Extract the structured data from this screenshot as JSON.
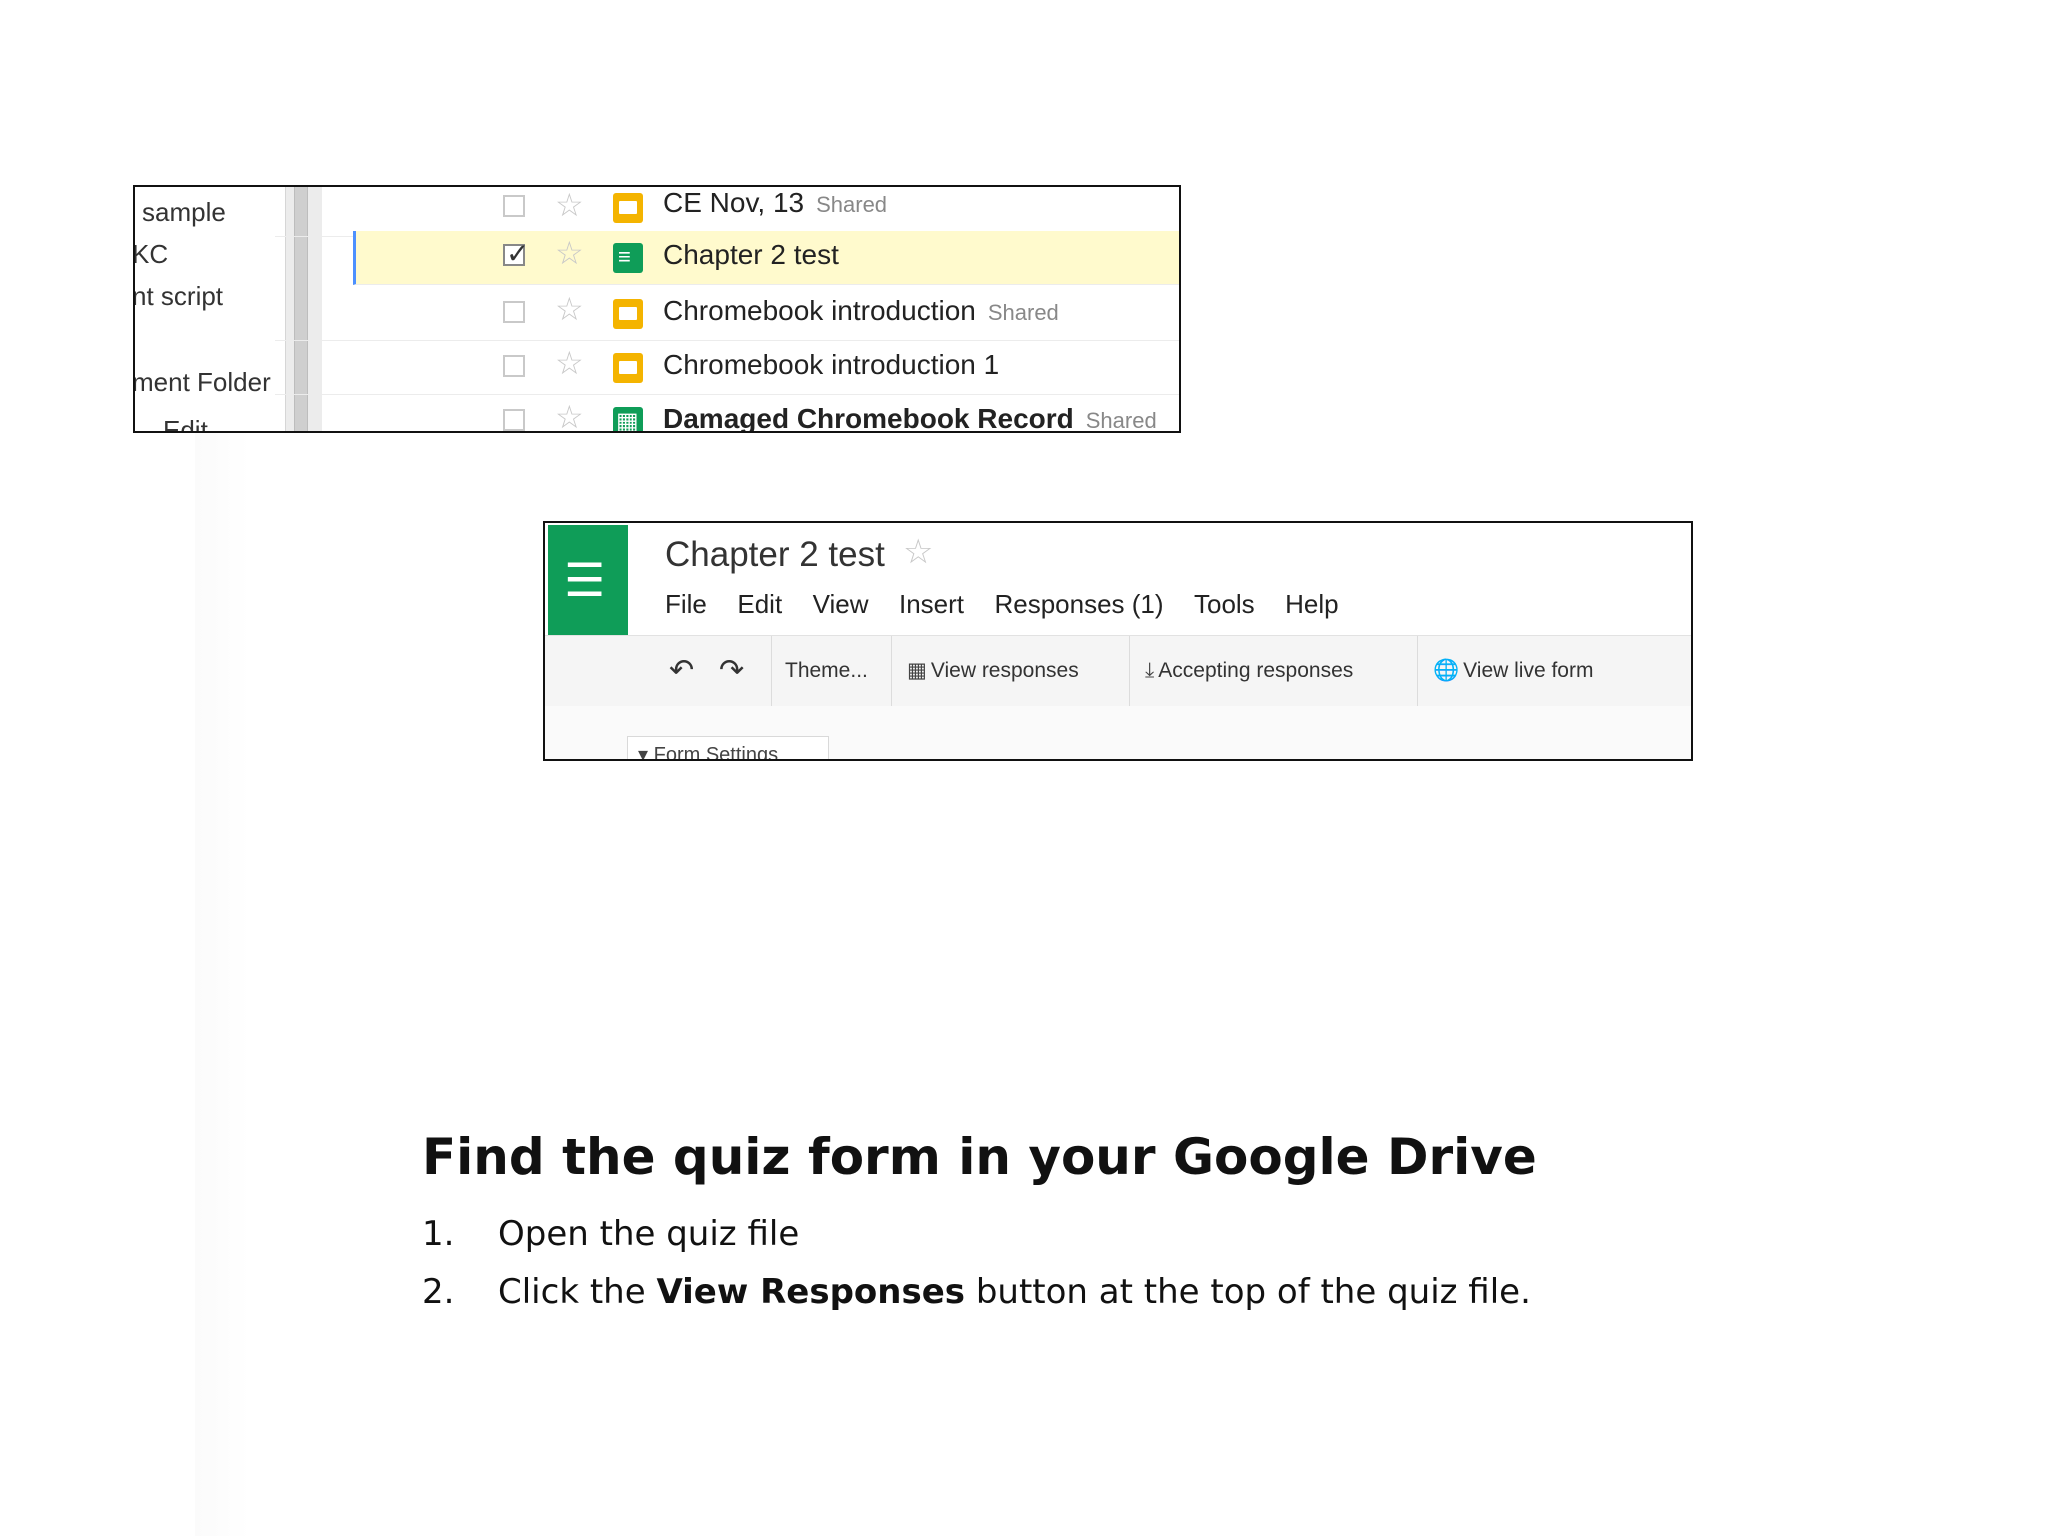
{
  "drive": {
    "sidebar_items": [
      "sample",
      "KC",
      "nt script",
      "ment Folder",
      "Edit"
    ],
    "files": [
      {
        "name": "CE Nov, 13",
        "badge": "Shared",
        "icon": "slides-icon",
        "checked": false,
        "bold": false
      },
      {
        "name": "Chapter 2 test",
        "badge": "",
        "icon": "forms-icon",
        "checked": true,
        "bold": false
      },
      {
        "name": "Chromebook introduction",
        "badge": "Shared",
        "icon": "slides-icon",
        "checked": false,
        "bold": false
      },
      {
        "name": "Chromebook introduction 1",
        "badge": "",
        "icon": "slides-icon",
        "checked": false,
        "bold": false
      },
      {
        "name": "Damaged Chromebook Record",
        "badge": "Shared",
        "icon": "sheets-icon",
        "checked": false,
        "bold": true
      }
    ]
  },
  "form_editor": {
    "title": "Chapter 2 test",
    "menus": [
      "File",
      "Edit",
      "View",
      "Insert",
      "Responses (1)",
      "Tools",
      "Help"
    ],
    "toolbar": {
      "theme": "Theme...",
      "view_responses": "View responses",
      "accepting_responses": "Accepting responses",
      "view_live_form": "View live form"
    },
    "form_settings": "Form Settings"
  },
  "instructions": {
    "heading": "Find the quiz form in your Google Drive",
    "step1_num": "1.",
    "step1_text": "Open the quiz file",
    "step2_num": "2.",
    "step2_prefix": "Click the ",
    "step2_bold": "View Responses",
    "step2_suffix": " button at the top of the quiz file."
  },
  "colors": {
    "forms_green": "#0f9d58",
    "slides_yellow": "#f4b400",
    "selected_row": "#fffacd",
    "selection_bar": "#4d90fe"
  }
}
